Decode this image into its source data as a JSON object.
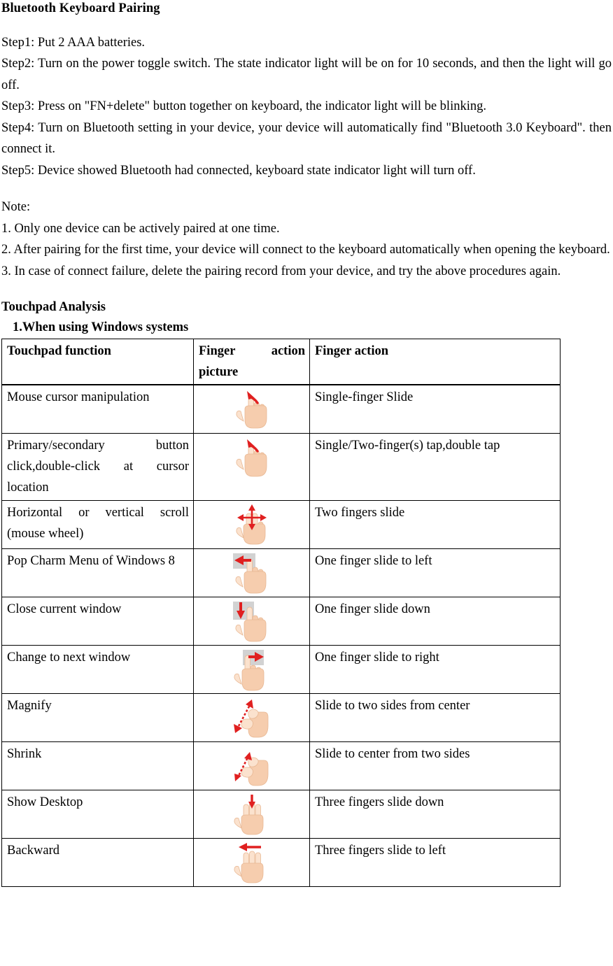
{
  "document": {
    "title": "Bluetooth Keyboard Pairing",
    "pairing_steps": [
      "Step1: Put 2 AAA batteries.",
      "Step2: Turn on the power toggle switch. The state indicator light will be on for 10 seconds, and then the light will go off.",
      "Step3: Press on \"FN+delete\" button together on keyboard, the indicator light will be blinking.",
      "Step4: Turn on Bluetooth setting in your device, your device will automatically find \"Bluetooth 3.0 Keyboard\". then connect it.",
      "Step5: Device showed Bluetooth had connected, keyboard state indicator light will turn off."
    ],
    "note_label": "Note:",
    "notes": [
      "1. Only one device can be actively paired at one time.",
      "2. After pairing for the first time, your device will connect to the keyboard automatically when opening the keyboard.",
      "3. In case of connect failure, delete the pairing record from your device, and try the above procedures again."
    ],
    "touchpad_heading": "Touchpad Analysis",
    "touchpad_subheading": "1.When using Windows systems"
  },
  "table": {
    "headers": [
      "Touchpad function",
      "Finger action picture",
      "Finger action"
    ],
    "rows": [
      {
        "function": "Mouse cursor manipulation",
        "icon": "one-finger-slide-icon",
        "action": "Single-finger Slide"
      },
      {
        "function": "Primary/secondary button click,double-click at cursor location",
        "icon": "one-finger-tap-icon",
        "action": "Single/Two-finger(s) tap,double tap"
      },
      {
        "function": "Horizontal or vertical scroll (mouse wheel)",
        "icon": "two-finger-scroll-icon",
        "action": "Two fingers slide"
      },
      {
        "function": "Pop Charm Menu of Windows 8",
        "icon": "one-finger-slide-left-icon",
        "action": "One finger slide to left"
      },
      {
        "function": "Close current window",
        "icon": "one-finger-slide-down-icon",
        "action": "One finger slide down"
      },
      {
        "function": "Change to next window",
        "icon": "one-finger-slide-right-icon",
        "action": "One finger slide to right"
      },
      {
        "function": "Magnify",
        "icon": "pinch-open-icon",
        "action": "Slide to two sides from center"
      },
      {
        "function": "Shrink",
        "icon": "pinch-close-icon",
        "action": "Slide to center from two sides"
      },
      {
        "function": "Show Desktop",
        "icon": "three-finger-slide-down-icon",
        "action": "Three fingers slide down"
      },
      {
        "function": "Backward",
        "icon": "three-finger-slide-left-icon",
        "action": "Three fingers slide to left"
      }
    ]
  },
  "colors": {
    "arrow_red": "#E02020",
    "skin_light": "#FBE2CE",
    "skin_mid": "#F6CDAE",
    "skin_outline": "#E8B894",
    "panel_gray": "#D2D2D2",
    "text": "#000000",
    "border": "#000000"
  }
}
